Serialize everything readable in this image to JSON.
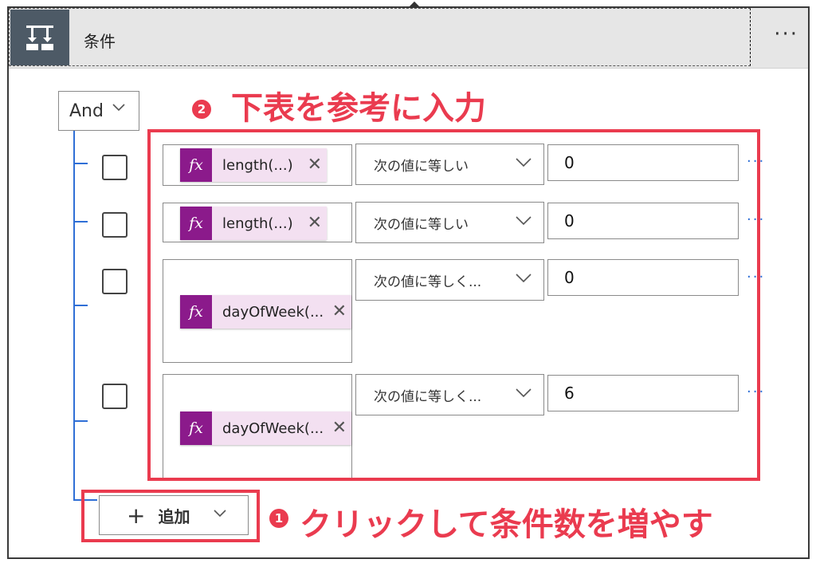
{
  "header": {
    "title": "条件",
    "more_label": "···"
  },
  "group": {
    "operator": "And"
  },
  "rows": [
    {
      "token_label": "length(...)",
      "operator": "次の値に等しい",
      "value": "0"
    },
    {
      "token_label": "length(...)",
      "operator": "次の値に等しい",
      "value": "0"
    },
    {
      "token_label": "dayOfWeek(...",
      "operator": "次の値に等しく...",
      "value": "0"
    },
    {
      "token_label": "dayOfWeek(...",
      "operator": "次の値に等しく...",
      "value": "6"
    }
  ],
  "token_icon_text": "fx",
  "token_remove_glyph": "✕",
  "row_more_label": "···",
  "add_button": {
    "plus": "+",
    "label": "追加"
  },
  "annotations": {
    "step1_number": "1",
    "step1_text": "クリックして条件数を増やす",
    "step2_number": "2",
    "step2_text": "下表を参考に入力",
    "color": "#ea3b4f"
  },
  "colors": {
    "token_icon_bg": "#8b1a8b",
    "token_bg": "#f3e0f1",
    "tree_line": "#2f6fd6",
    "header_icon_bg": "#4d5a66"
  },
  "icons": [
    "condition-icon",
    "chevron-down-icon",
    "more-icon",
    "close-icon",
    "plus-icon"
  ]
}
